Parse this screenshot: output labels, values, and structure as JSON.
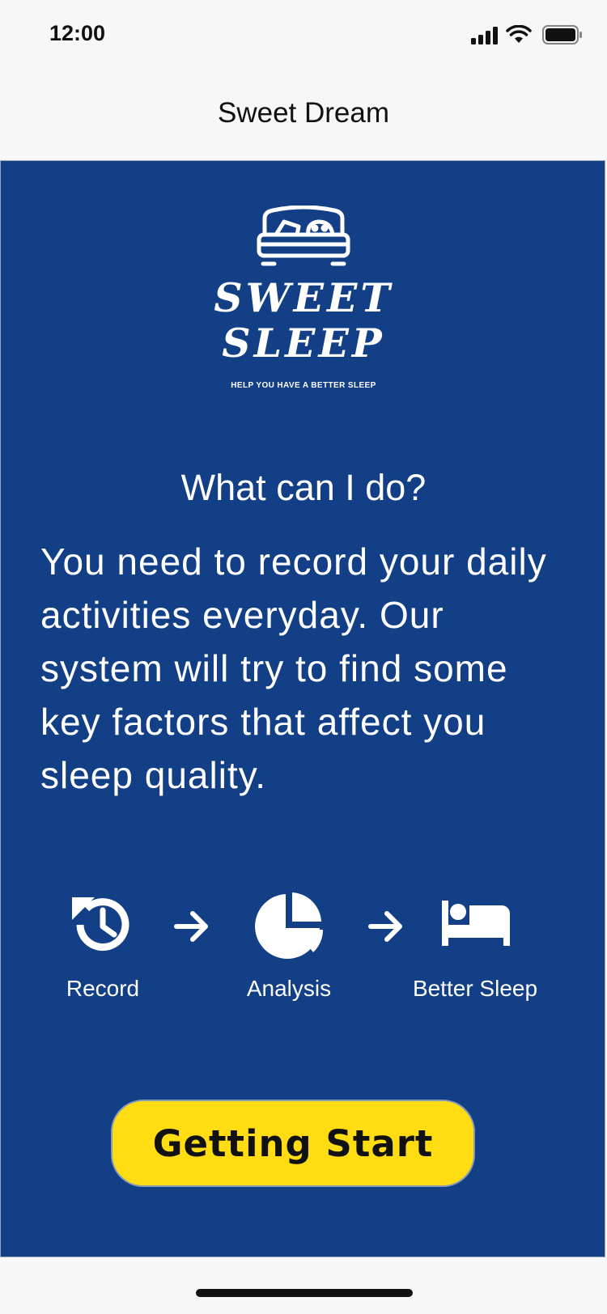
{
  "status_bar": {
    "time": "12:00",
    "icons": [
      "signal-icon",
      "wifi-icon",
      "battery-icon"
    ]
  },
  "nav": {
    "title": "Sweet Dream"
  },
  "logo": {
    "icon": "bed-icon",
    "line1": "SWEET",
    "line2": "SLEEP",
    "tagline": "HELP YOU HAVE A BETTER SLEEP"
  },
  "content": {
    "heading": "What can I do?",
    "description": "You need to record your daily activities everyday. Our system will try to find some key factors that affect you sleep quality."
  },
  "steps": [
    {
      "label": "Record",
      "icon": "history-icon"
    },
    {
      "label": "Analysis",
      "icon": "pie-chart-icon"
    },
    {
      "label": "Better Sleep",
      "icon": "bed-icon"
    }
  ],
  "cta": {
    "label": "Getting Start"
  },
  "colors": {
    "background": "#133f86",
    "button": "#ffdd12",
    "text": "#ffffff"
  }
}
